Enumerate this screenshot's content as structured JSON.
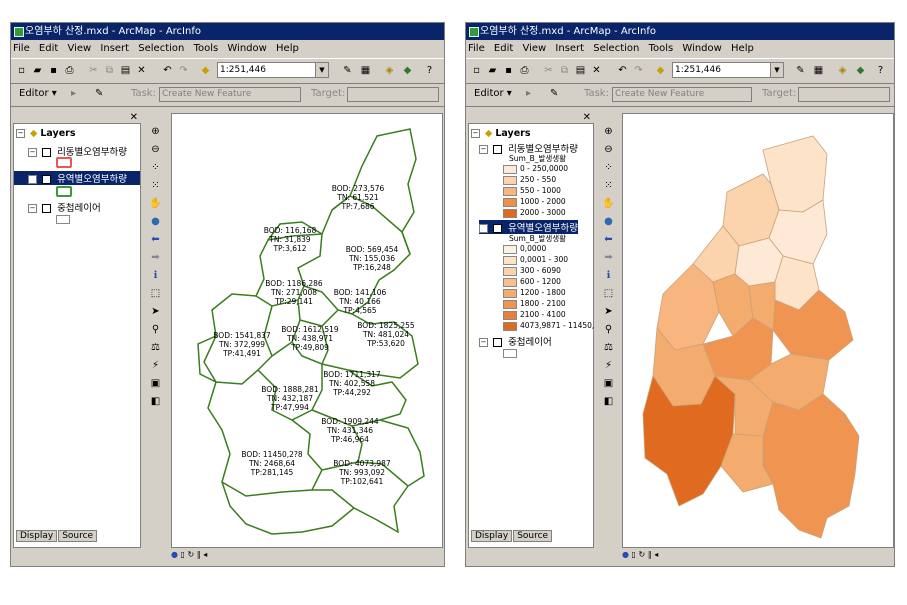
{
  "left_window": {
    "title": "오염부하 산정.mxd - ArcMap - ArcInfo",
    "menu": [
      "File",
      "Edit",
      "View",
      "Insert",
      "Selection",
      "Tools",
      "Window",
      "Help"
    ],
    "scale": "1:251,446",
    "editor_label": "Editor ▾",
    "task_label": "Task:",
    "task_value": "Create New Feature",
    "target_label": "Target:",
    "toc": {
      "root": "Layers",
      "layers": [
        {
          "name": "리동별오염부하량",
          "checked": false
        },
        {
          "name": "유역별오염부하량",
          "checked": true,
          "selected": true
        },
        {
          "name": "중첩레이어",
          "checked": false
        }
      ],
      "tabs": [
        "Display",
        "Source"
      ]
    },
    "map_labels": [
      {
        "bod": "BOD: 273,576",
        "tn": "TN: 61,521",
        "tp": "TP:7,686"
      },
      {
        "bod": "BOD: 116,168",
        "tn": "TN: 31,839",
        "tp": "TP:3,612"
      },
      {
        "bod": "BOD: 569,454",
        "tn": "TN: 155,036",
        "tp": "TP:16,248"
      },
      {
        "bod": "BOD: 1186,286",
        "tn": "TN: 271,008",
        "tp": "TP:29,141"
      },
      {
        "bod": "BOD: 141,106",
        "tn": "TN: 40,166",
        "tp": "TP:4,565"
      },
      {
        "bod": "BOD: 1541,837",
        "tn": "TN: 372,999",
        "tp": "TP:41,491"
      },
      {
        "bod": "BOD: 1612,519",
        "tn": "TN: 438,971",
        "tp": "TP:49,809"
      },
      {
        "bod": "BOD: 1825,255",
        "tn": "TN: 481,024",
        "tp": "TP:53,620"
      },
      {
        "bod": "BOD: 1711,317",
        "tn": "TN: 402,558",
        "tp": "TP:44,292"
      },
      {
        "bod": "BOD: 1888,281",
        "tn": "TN: 432,187",
        "tp": "TP:47,994"
      },
      {
        "bod": "BOD: 1909,244",
        "tn": "TN: 431,346",
        "tp": "TP:46,964"
      },
      {
        "bod": "BOD: 11450,2?8",
        "tn": "TN: 2468,64",
        "tp": "TP:281,145"
      },
      {
        "bod": "BOD: 4073,987",
        "tn": "TN: 993,092",
        "tp": "TP:102,641"
      }
    ]
  },
  "right_window": {
    "title": "오염부하 산정.mxd - ArcMap - ArcInfo",
    "menu": [
      "File",
      "Edit",
      "View",
      "Insert",
      "Selection",
      "Tools",
      "Window",
      "Help"
    ],
    "scale": "1:251,446",
    "editor_label": "Editor ▾",
    "task_label": "Task:",
    "task_value": "Create New Feature",
    "target_label": "Target:",
    "toc": {
      "root": "Layers",
      "layer1": "리동별오염부하량",
      "layer1_field": "Sum_B_발생생활",
      "layer1_classes": [
        {
          "label": "0 - 250,0000",
          "color": "#fde9d6"
        },
        {
          "label": "250 - 550",
          "color": "#fbd3ad"
        },
        {
          "label": "550 - 1000",
          "color": "#f7b57f"
        },
        {
          "label": "1000 - 2000",
          "color": "#f08f4a"
        },
        {
          "label": "2000 - 3000",
          "color": "#e06a1f"
        }
      ],
      "layer2": "유역별오염부하량",
      "layer2_field": "Sum_B_발생생활",
      "layer2_classes": [
        {
          "label": "0,0000",
          "color": "#fdf1e4"
        },
        {
          "label": "0,0001 - 300",
          "color": "#fce3c8"
        },
        {
          "label": "300 - 6090",
          "color": "#fad3ab"
        },
        {
          "label": "600 - 1200",
          "color": "#f7c08d"
        },
        {
          "label": "1200 - 1800",
          "color": "#f4ab6e"
        },
        {
          "label": "1800 - 2100",
          "color": "#ef9551"
        },
        {
          "label": "2100 - 4100",
          "color": "#e97f38"
        },
        {
          "label": "4073,9871 - 11450,",
          "color": "#e06a1f"
        }
      ],
      "layer3": "중첩레이어",
      "tabs": [
        "Display",
        "Source"
      ]
    }
  },
  "colors": {
    "title_bar": "#0a246a",
    "window_bg": "#d4d0c8",
    "boundary_green": "#3a7d1e"
  }
}
